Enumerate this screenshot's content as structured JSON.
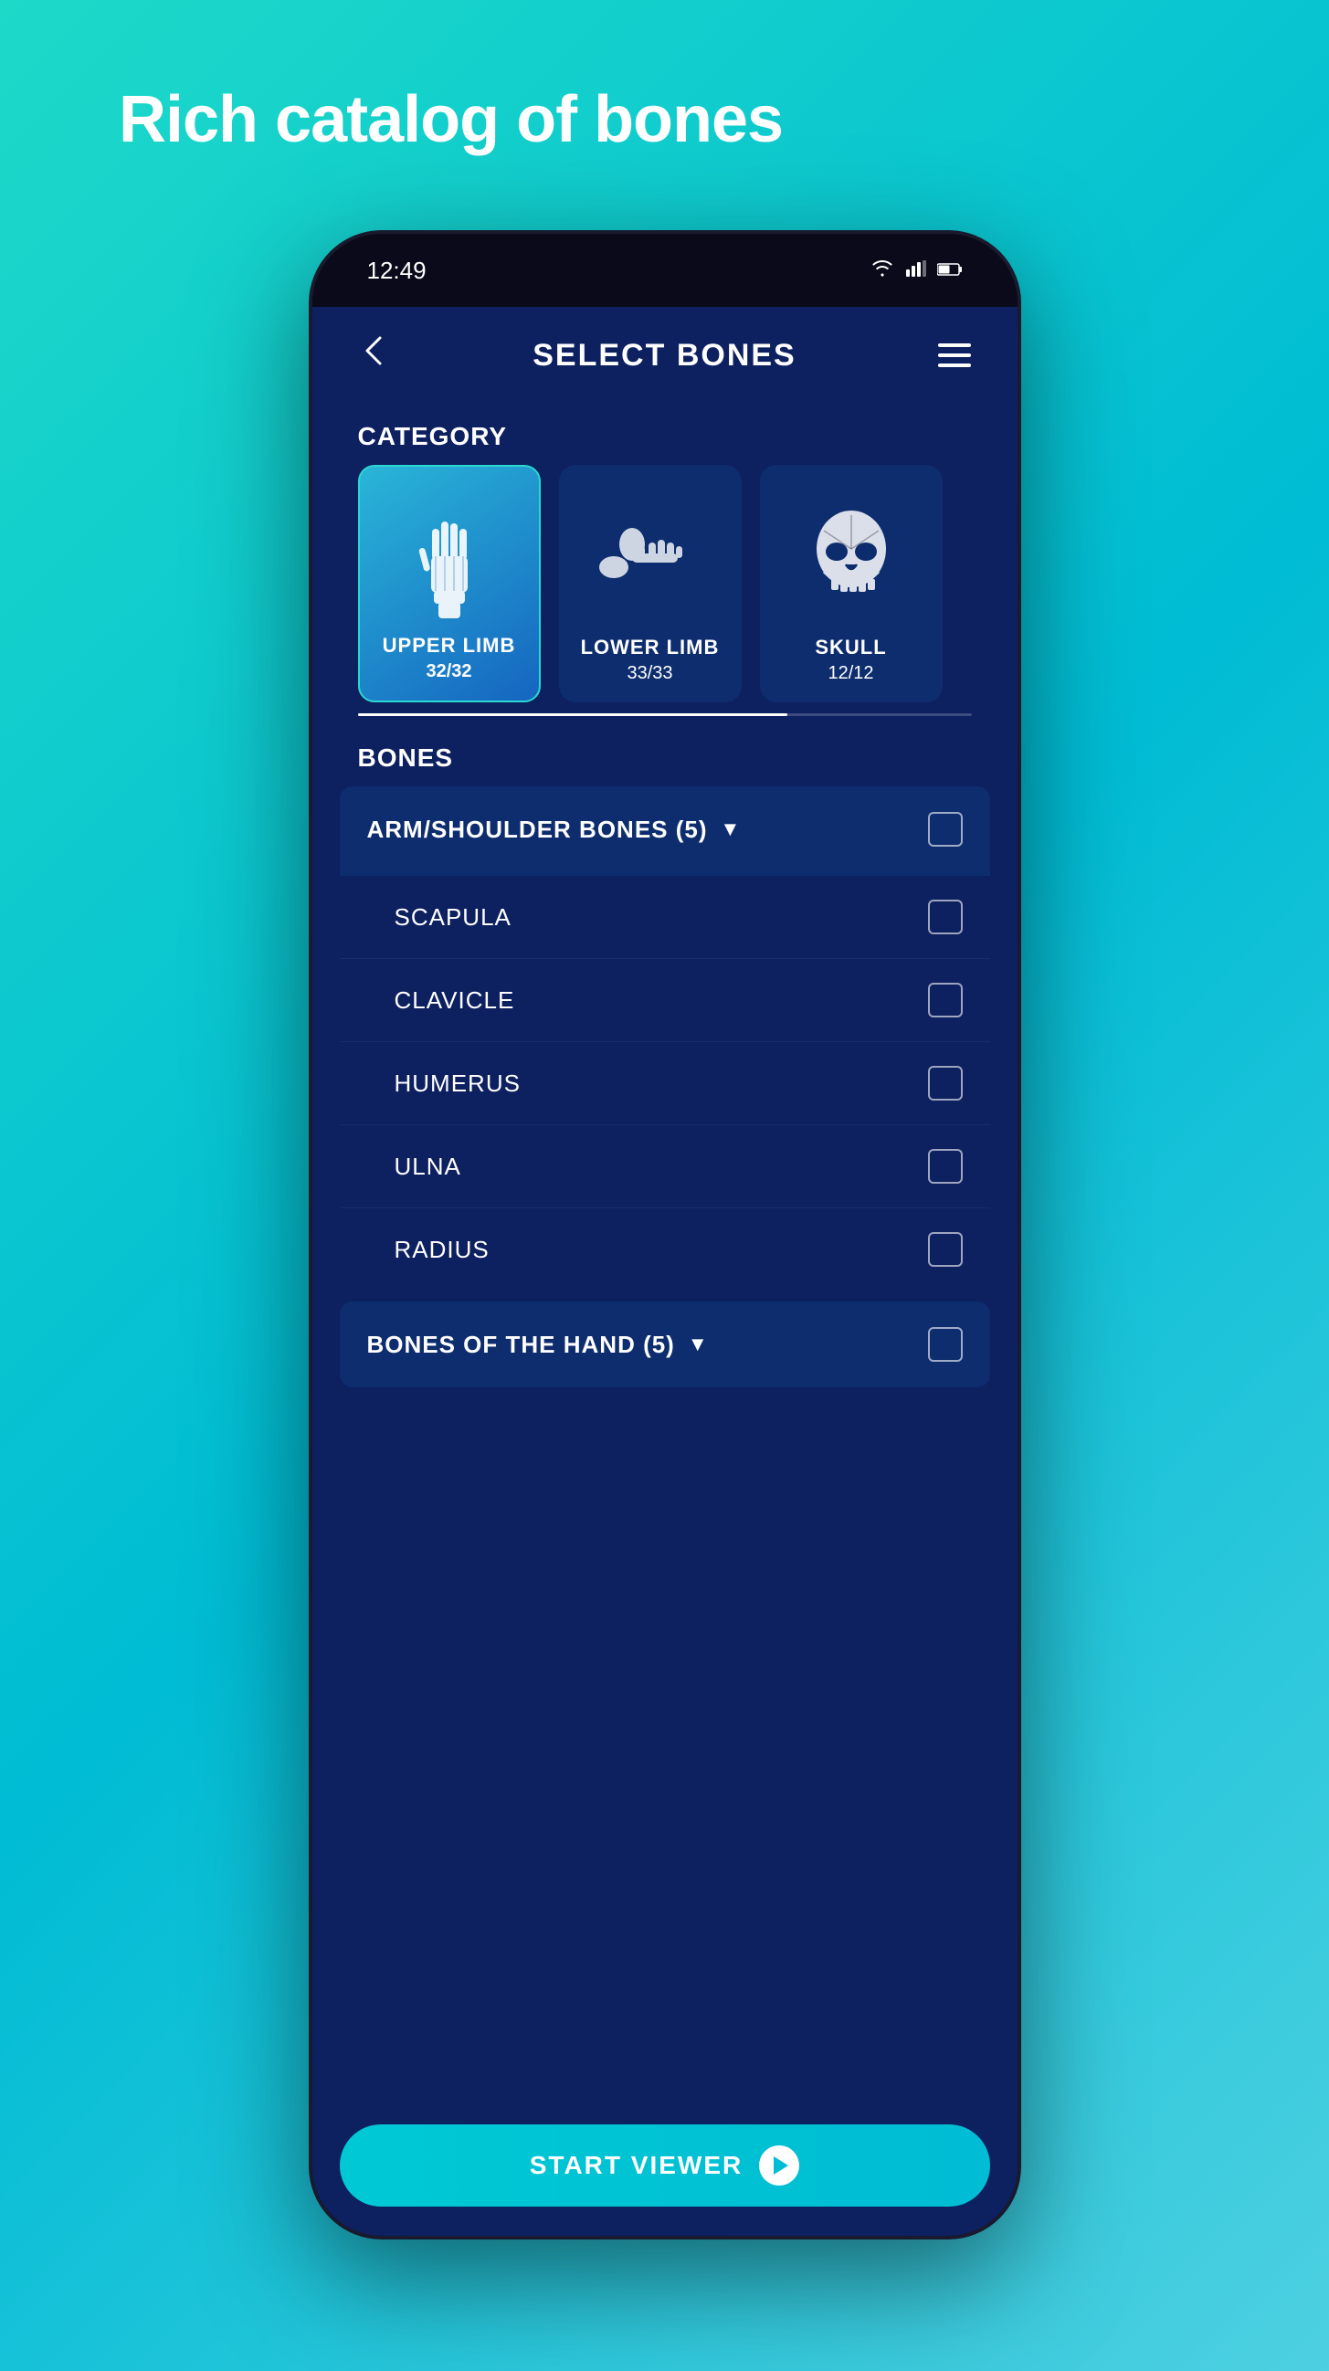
{
  "page": {
    "title": "Rich catalog of bones",
    "status_time": "12:49"
  },
  "header": {
    "title": "SELECT BONES",
    "back_label": "←",
    "menu_label": "☰"
  },
  "category": {
    "label": "CATEGORY",
    "cards": [
      {
        "id": "upper-limb",
        "name": "UPPER LIMB",
        "count": "32/32",
        "active": true
      },
      {
        "id": "lower-limb",
        "name": "LOWER LIMB",
        "count": "33/33",
        "active": false
      },
      {
        "id": "skull",
        "name": "SKULL",
        "count": "12/12",
        "active": false
      }
    ]
  },
  "bones": {
    "label": "BONES",
    "groups": [
      {
        "id": "arm-shoulder",
        "name": "ARM/SHOULDER BONES (5)",
        "expanded": true,
        "items": [
          {
            "name": "SCAPULA"
          },
          {
            "name": "CLAVICLE"
          },
          {
            "name": "HUMERUS"
          },
          {
            "name": "ULNA"
          },
          {
            "name": "RADIUS"
          }
        ]
      },
      {
        "id": "bones-of-hand",
        "name": "BONES OF THE HAND (5)",
        "expanded": false,
        "items": []
      }
    ]
  },
  "start_button": {
    "label": "START VIEWER"
  }
}
